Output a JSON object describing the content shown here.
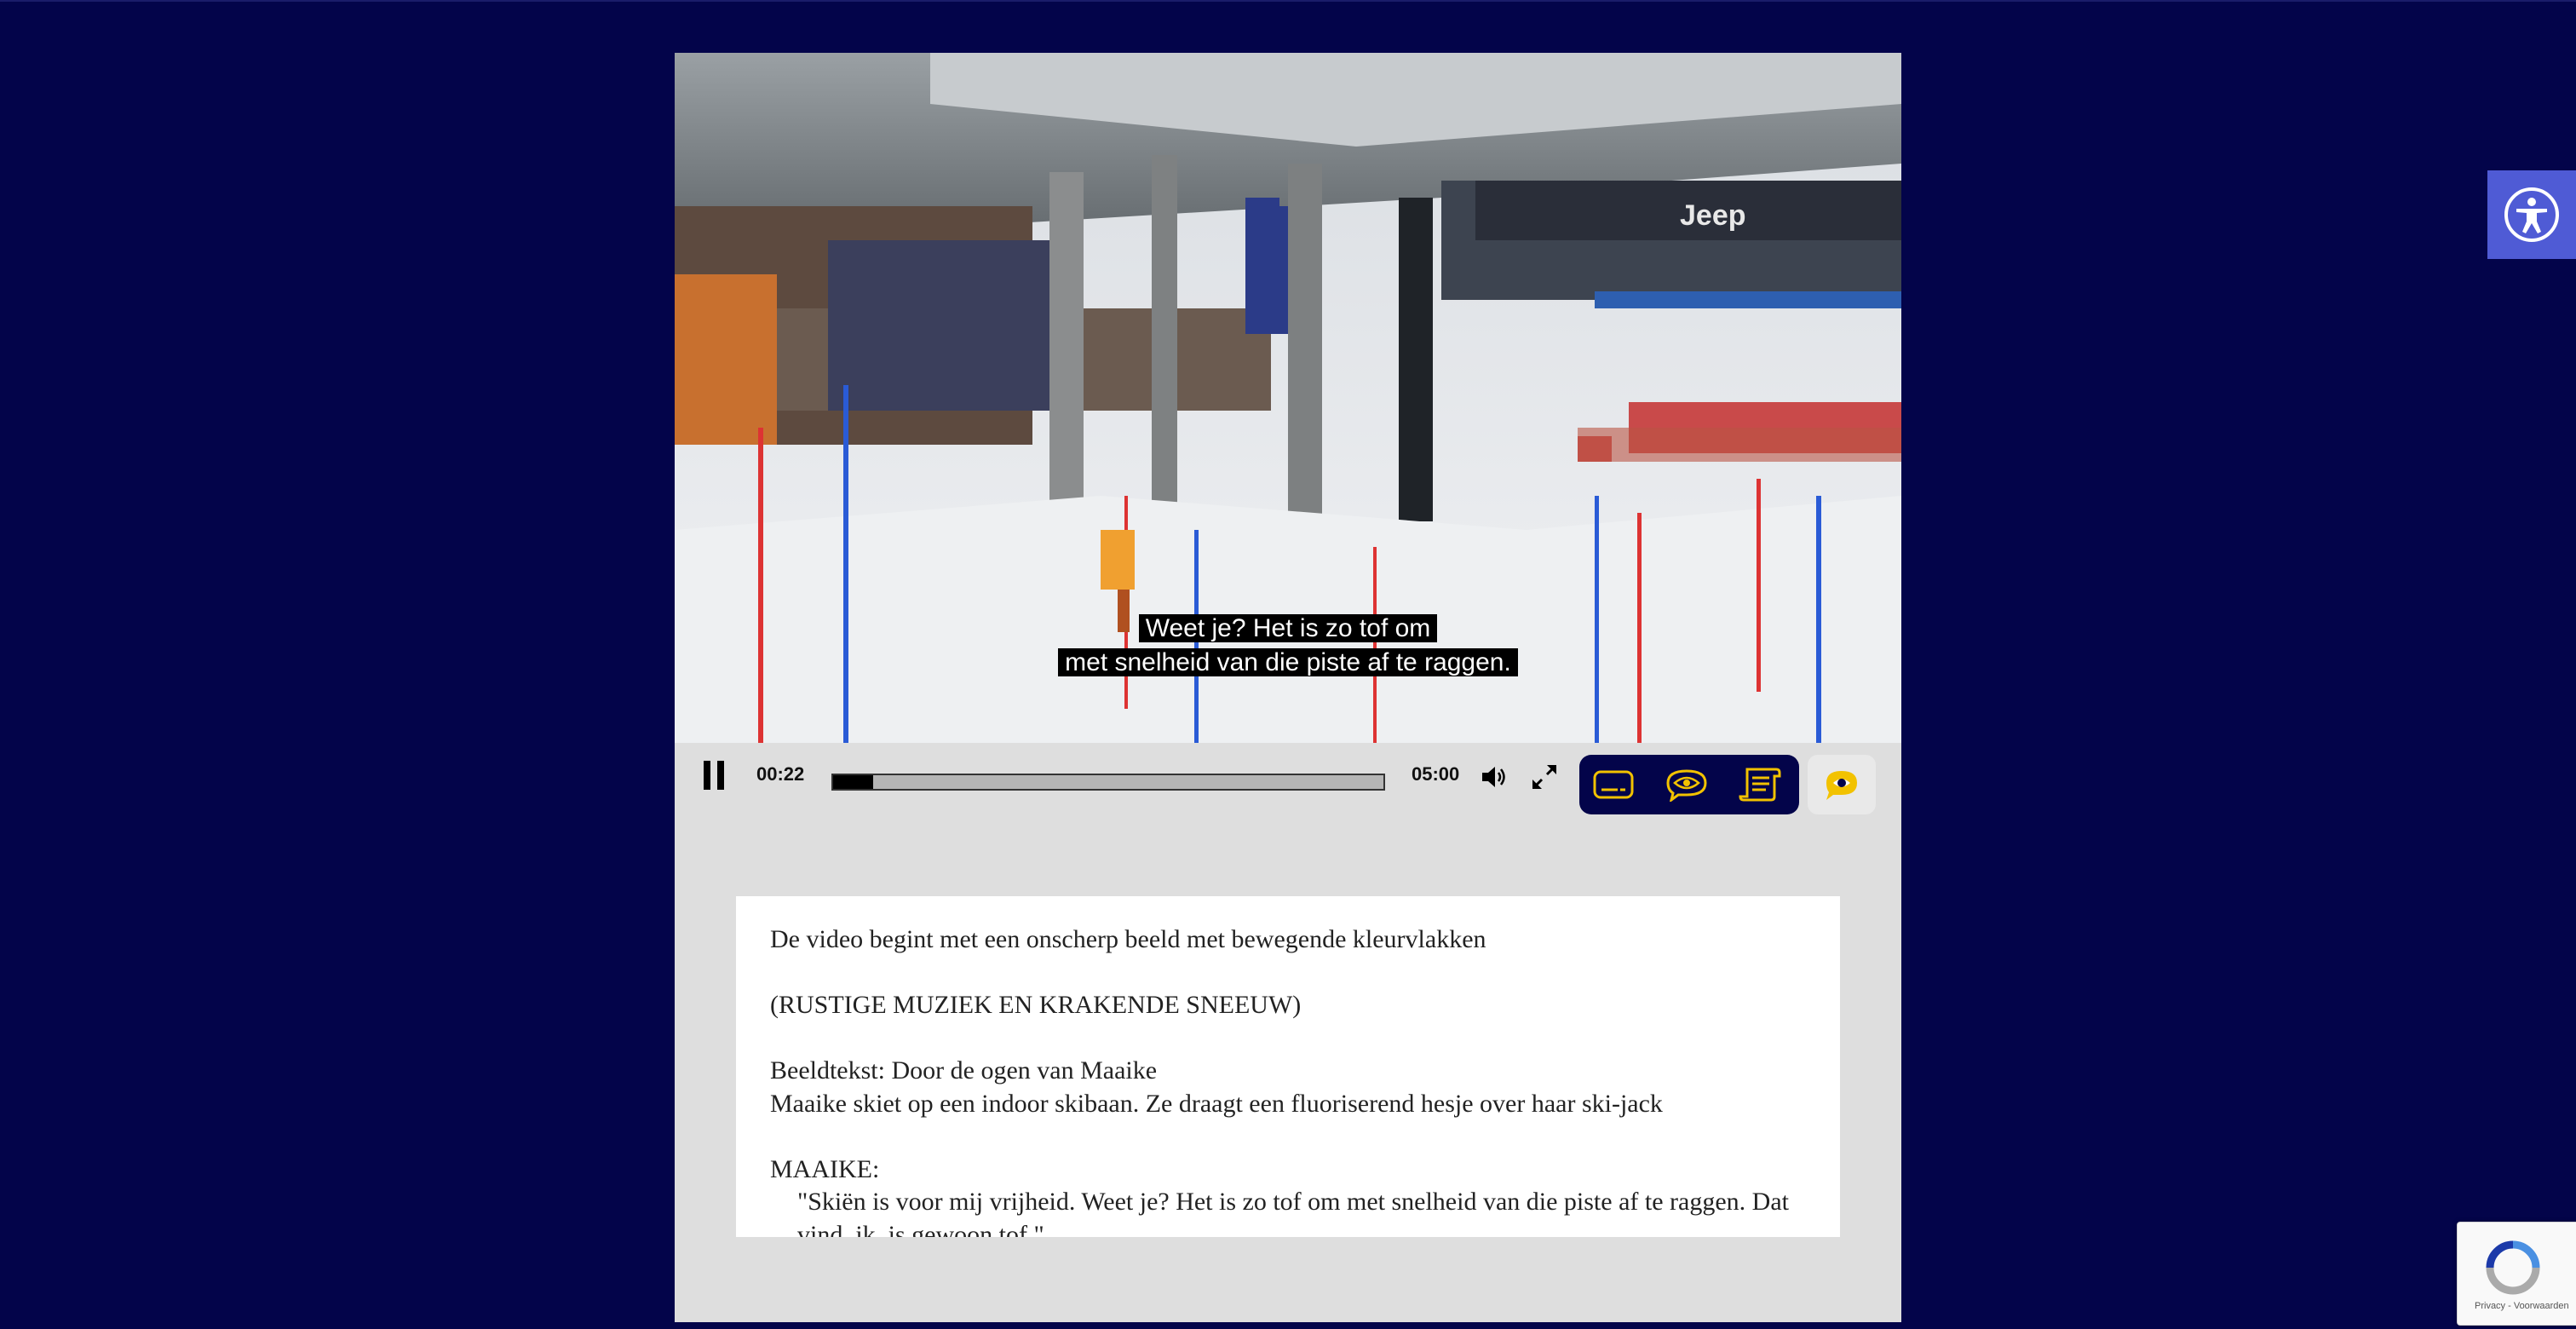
{
  "video": {
    "subtitle_line1": "Weet je? Het is zo tof om",
    "subtitle_line2": "met snelheid van die piste af te raggen."
  },
  "controls": {
    "play_state_icon": "pause-icon",
    "current_time": "00:22",
    "total_time": "05:00",
    "progress_fraction": 0.073,
    "volume_icon": "speaker-icon",
    "fullscreen_icon": "expand-icon",
    "tools": [
      {
        "name": "captions",
        "icon": "subtitles-icon"
      },
      {
        "name": "audio-description",
        "icon": "eye-speech-icon"
      },
      {
        "name": "transcript",
        "icon": "transcript-icon"
      },
      {
        "name": "sign-language",
        "icon": "sign-language-icon"
      }
    ],
    "accent_color": "#f2c200",
    "tool_group_bg": "#03044a"
  },
  "transcript": {
    "paragraphs": [
      {
        "lines": [
          "De video begint met een onscherp beeld met bewegende kleurvlakken"
        ]
      },
      {
        "lines": [
          "(RUSTIGE MUZIEK EN KRAKENDE SNEEUW)"
        ]
      },
      {
        "lines": [
          "Beeldtekst: Door de ogen van Maaike",
          "Maaike skiet op een indoor skibaan. Ze draagt een fluoriserend hesje over haar ski-jack"
        ]
      },
      {
        "lines": [
          "MAAIKE:"
        ],
        "quote": "\"Skiën is voor mij vrijheid. Weet je? Het is zo tof om met snelheid van die piste af te raggen. Dat vind, ik, is gewoon tof.\""
      }
    ]
  },
  "page": {
    "background": "#03044a",
    "accessibility_button_icon": "accessibility-person-icon",
    "recaptcha_links": "Privacy - Voorwaarden"
  }
}
